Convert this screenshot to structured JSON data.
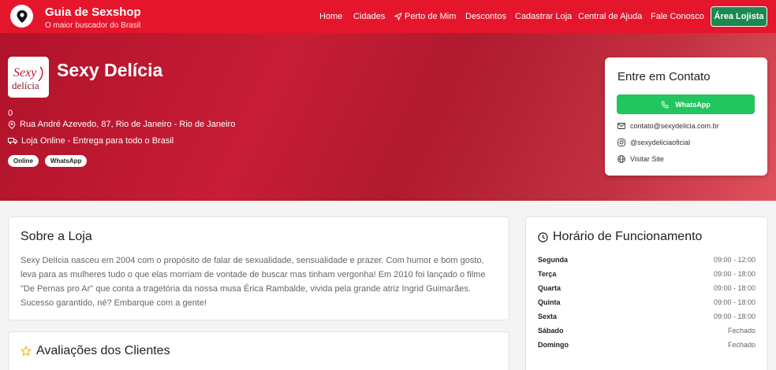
{
  "brand": {
    "title": "Guia de Sexshop",
    "subtitle": "O maior buscador do Brasil"
  },
  "nav": {
    "links": [
      "Home",
      "Cidades",
      "Perto de Mim",
      "Descontos",
      "Cadastrar Loja",
      "Central de Ajuda",
      "Fale Conosco"
    ],
    "cta": "Área Lojista"
  },
  "store": {
    "name": "Sexy Delícia",
    "logo_text_top": "Sexy",
    "logo_text_bottom": "delícia",
    "rating": "0",
    "address": "Rua André Azevedo, 87, Rio de Janeiro - Rio de Janeiro",
    "delivery": "Loja Online - Entrega para todo o Brasil",
    "badges": [
      "Online",
      "WhatsApp"
    ]
  },
  "contact": {
    "title": "Entre em Contato",
    "whatsapp_label": "WhatsApp",
    "email": "contato@sexydelicia.com.br",
    "instagram": "@sexydeliciaoficial",
    "site": "Visitar Site"
  },
  "about": {
    "title": "Sobre a Loja",
    "text": "Sexy Delícia nasceu em 2004 com o propósito de falar de sexualidade, sensualidade e prazer. Com humor e bom gosto, leva para as mulheres tudo o que elas morriam de vontade de buscar mas tinham vergonha! Em 2010 foi lançado o filme \"De Pernas pro Ar\" que conta a tragetória da nossa musa Érica Rambalde, vivida pela grande atriz Ingrid Guimarães. Sucesso garantido, né? Embarque com a gente!"
  },
  "reviews": {
    "title": "Avaliações dos Clientes"
  },
  "hours": {
    "title": "Horário de Funcionamento",
    "rows": [
      {
        "day": "Segunda",
        "time": "09:00 - 12:00"
      },
      {
        "day": "Terça",
        "time": "09:00 - 18:00"
      },
      {
        "day": "Quarta",
        "time": "09:00 - 18:00"
      },
      {
        "day": "Quinta",
        "time": "09:00 - 18:00"
      },
      {
        "day": "Sexta",
        "time": "09:00 - 18:00"
      },
      {
        "day": "Sábado",
        "time": "Fechado"
      },
      {
        "day": "Domingo",
        "time": "Fechado"
      }
    ]
  },
  "colors": {
    "nav_red": "#e5162c",
    "hero_red": "#c81d36",
    "whatsapp_green": "#22c55e",
    "cta_green": "#1a8a4f",
    "star_gold": "#f5b301"
  },
  "icons": [
    "map-pin-icon",
    "location-pin-icon",
    "truck-icon",
    "phone-icon",
    "mail-icon",
    "instagram-icon",
    "globe-icon",
    "clock-icon",
    "star-icon",
    "paper-plane-icon"
  ]
}
